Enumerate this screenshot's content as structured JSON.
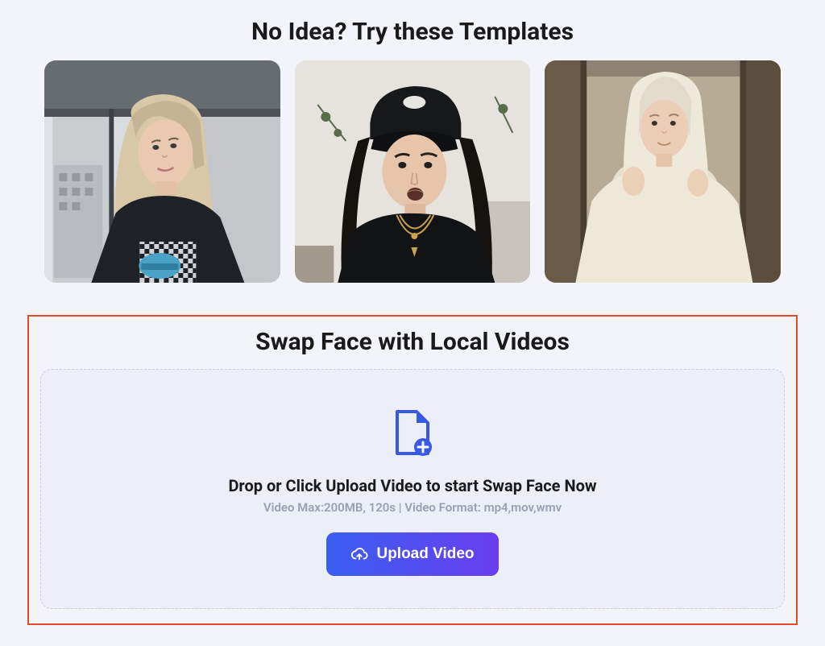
{
  "templates": {
    "title": "No Idea? Try these Templates",
    "items": [
      {
        "name": "template-1"
      },
      {
        "name": "template-2"
      },
      {
        "name": "template-3"
      }
    ]
  },
  "upload": {
    "title": "Swap Face with Local Videos",
    "drop_text": "Drop or Click Upload Video to start Swap Face Now",
    "hint": "Video Max:200MB, 120s | Video Format: mp4,mov,wmv",
    "button_label": "Upload Video"
  }
}
